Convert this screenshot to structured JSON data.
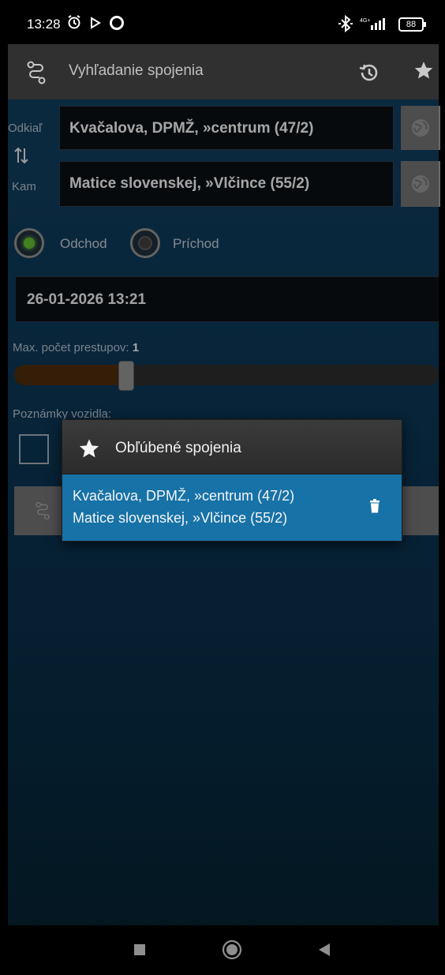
{
  "status_bar": {
    "time": "13:28",
    "battery": "88"
  },
  "app_bar": {
    "title": "Vyhľadanie spojenia"
  },
  "form": {
    "from_label": "Odkiaľ",
    "from_value": "Kvačalova, DPMŽ, »centrum (47/2)",
    "to_label": "Kam",
    "to_value": "Matice slovenskej, »Vlčince (55/2)",
    "departure_label": "Odchod",
    "arrival_label": "Príchod",
    "selected_mode": "departure",
    "datetime": "26-01-2026  13:21",
    "max_transfers_label": "Max. počet prestupov:",
    "max_transfers_value": "1",
    "vehicle_notes_label": "Poznámky vozidla:"
  },
  "popup": {
    "title": "Obľúbené spojenia",
    "items": [
      {
        "line1": "Kvačalova, DPMŽ, »centrum (47/2)",
        "line2": "Matice slovenskej, »Vlčince (55/2)"
      }
    ]
  },
  "colors": {
    "accent": "#1772a7",
    "radio_active": "#5ab22a",
    "background": "#0b3350"
  },
  "icons": {
    "app": "route-icon",
    "history": "history-icon",
    "favorite": "star-icon",
    "swap": "swap-icon",
    "globe": "globe-icon",
    "delete": "trash-icon"
  }
}
